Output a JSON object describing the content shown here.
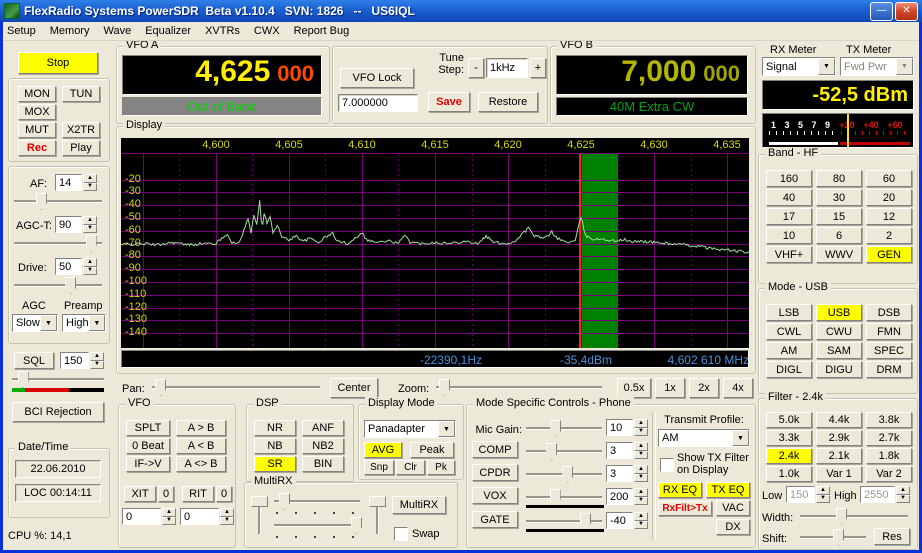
{
  "window": {
    "title": "FlexRadio Systems PowerSDR  Beta v1.10.4   SVN: 1826   --   US6IQL"
  },
  "menu": {
    "items": [
      "Setup",
      "Memory",
      "Wave",
      "Equalizer",
      "XVTRs",
      "CWX",
      "Report Bug"
    ]
  },
  "left": {
    "stop": "Stop",
    "mon": "MON",
    "tun": "TUN",
    "mox": "MOX",
    "mut": "MUT",
    "x2tr": "X2TR",
    "rec": "Rec",
    "play": "Play",
    "af_label": "AF:",
    "af_value": "14",
    "agct_label": "AGC-T:",
    "agct_value": "90",
    "drive_label": "Drive:",
    "drive_value": "50",
    "agc_label": "AGC",
    "agc_value": "Slow",
    "preamp_label": "Preamp",
    "preamp_value": "High",
    "sql_label": "SQL",
    "sql_value": "150",
    "bci_label": "BCI Rejection",
    "datetime_label": "Date/Time",
    "date": "22.06.2010",
    "loc_time": "LOC 00:14:11",
    "cpu": "CPU %: 14,1"
  },
  "vfo_a": {
    "label": "VFO A",
    "digits": "4,625",
    "sub_digits": "000",
    "band_text": "Out of Band"
  },
  "tune": {
    "vfo_lock": "VFO Lock",
    "freq_entry": "7.000000",
    "step_label_1": "Tune",
    "step_label_2": "Step:",
    "minus": "-",
    "step": "1kHz",
    "plus": "+",
    "save": "Save",
    "restore": "Restore"
  },
  "vfo_b": {
    "label": "VFO B",
    "digits": "7,000",
    "sub_digits": "000",
    "band_text": "40M Extra CW"
  },
  "meters": {
    "rx_label": "RX Meter",
    "tx_label": "TX Meter",
    "rx_selected": "Signal",
    "tx_selected": "Fwd Pwr",
    "reading": "-52,5 dBm",
    "smeter_white": [
      "1",
      "3",
      "5",
      "7",
      "9"
    ],
    "smeter_red": [
      "+20",
      "+40",
      "+60"
    ]
  },
  "band_panel": {
    "label": "Band - HF",
    "buttons": [
      "160",
      "80",
      "60",
      "40",
      "30",
      "20",
      "17",
      "15",
      "12",
      "10",
      "6",
      "2",
      "VHF+",
      "WWV",
      "GEN"
    ],
    "active": "GEN"
  },
  "mode_panel": {
    "label": "Mode - USB",
    "buttons": [
      "LSB",
      "USB",
      "DSB",
      "CWL",
      "CWU",
      "FMN",
      "AM",
      "SAM",
      "SPEC",
      "DIGL",
      "DIGU",
      "DRM"
    ],
    "active": "USB"
  },
  "filter_panel": {
    "label": "Filter - 2.4k",
    "buttons": [
      "5.0k",
      "4.4k",
      "3.8k",
      "3.3k",
      "2.9k",
      "2.7k",
      "2.4k",
      "2.1k",
      "1.8k",
      "1.0k",
      "Var 1",
      "Var 2"
    ],
    "active": "2.4k",
    "low_label": "Low",
    "low_value": "150",
    "high_label": "High",
    "high_value": "2550",
    "width_label": "Width:",
    "shift_label": "Shift:",
    "res": "Res"
  },
  "display": {
    "label": "Display",
    "freq_ticks": [
      "4,600",
      "4,605",
      "4,610",
      "4,615",
      "4,620",
      "4,625",
      "4,630",
      "4,635"
    ],
    "db_max": -20,
    "db_min": -140,
    "db_step": 10,
    "axis": {
      "fmin_khz": 4593.5,
      "fmax_khz": 4636.5
    },
    "passband": {
      "start_khz": 4625.0,
      "width_khz": 2.55
    },
    "status_hz": "-22390,1Hz",
    "status_dbm": "-35,4dBm",
    "status_freq": "4,602 610 MHz",
    "trace": [
      [
        4593.5,
        -71
      ],
      [
        4595,
        -70
      ],
      [
        4596,
        -71
      ],
      [
        4597,
        -69
      ],
      [
        4598,
        -71
      ],
      [
        4599,
        -70
      ],
      [
        4600,
        -70
      ],
      [
        4600.8,
        -62
      ],
      [
        4601.1,
        -70
      ],
      [
        4601.6,
        -69
      ],
      [
        4602,
        -57
      ],
      [
        4602.2,
        -50
      ],
      [
        4602.4,
        -62
      ],
      [
        4602.6,
        -48
      ],
      [
        4602.8,
        -55
      ],
      [
        4603,
        -35
      ],
      [
        4603.15,
        -60
      ],
      [
        4603.3,
        -46
      ],
      [
        4603.5,
        -55
      ],
      [
        4603.7,
        -48
      ],
      [
        4603.9,
        -62
      ],
      [
        4604.2,
        -55
      ],
      [
        4604.5,
        -65
      ],
      [
        4605,
        -67
      ],
      [
        4605.5,
        -64
      ],
      [
        4606,
        -68
      ],
      [
        4606.5,
        -66
      ],
      [
        4607,
        -69
      ],
      [
        4607.5,
        -65
      ],
      [
        4608,
        -62
      ],
      [
        4608.3,
        -68
      ],
      [
        4609,
        -70
      ],
      [
        4609.5,
        -66
      ],
      [
        4610,
        -61
      ],
      [
        4610.3,
        -67
      ],
      [
        4611,
        -69
      ],
      [
        4612,
        -68
      ],
      [
        4612.5,
        -70
      ],
      [
        4613,
        -63
      ],
      [
        4613.3,
        -69
      ],
      [
        4614,
        -70
      ],
      [
        4615,
        -69
      ],
      [
        4616,
        -70
      ],
      [
        4617,
        -68
      ],
      [
        4618,
        -70
      ],
      [
        4618.5,
        -64
      ],
      [
        4619,
        -69
      ],
      [
        4620,
        -70
      ],
      [
        4620.5,
        -68
      ],
      [
        4621,
        -62
      ],
      [
        4621.4,
        -58
      ],
      [
        4621.8,
        -64
      ],
      [
        4622.5,
        -66
      ],
      [
        4623,
        -61
      ],
      [
        4623.4,
        -66
      ],
      [
        4624,
        -69
      ],
      [
        4624.6,
        -68
      ],
      [
        4625,
        -49
      ],
      [
        4625.3,
        -64
      ],
      [
        4626,
        -67
      ],
      [
        4626.5,
        -66
      ],
      [
        4627,
        -68
      ],
      [
        4628,
        -67
      ],
      [
        4628.5,
        -69
      ],
      [
        4629,
        -68
      ],
      [
        4630,
        -69
      ],
      [
        4631,
        -70
      ],
      [
        4632,
        -71
      ],
      [
        4633,
        -72
      ],
      [
        4634,
        -74
      ],
      [
        4635,
        -75
      ],
      [
        4636.5,
        -77
      ]
    ]
  },
  "panzoom": {
    "pan_label": "Pan:",
    "center": "Center",
    "zoom_label": "Zoom:",
    "zoom_buttons": [
      "0.5x",
      "1x",
      "2x",
      "4x"
    ]
  },
  "vfo_ctrl": {
    "label": "VFO",
    "splt": "SPLT",
    "a_gt_b": "A > B",
    "zero_beat": "0 Beat",
    "a_lt_b": "A < B",
    "if_v": "IF->V",
    "a_swap_b": "A <> B",
    "xit": "XIT",
    "xit_clear": "0",
    "rit": "RIT",
    "rit_clear": "0",
    "xit_value": "0",
    "rit_value": "0"
  },
  "dsp_panel": {
    "label": "DSP",
    "nr": "NR",
    "anf": "ANF",
    "nb": "NB",
    "nb2": "NB2",
    "sr": "SR",
    "bin": "BIN",
    "active": "SR"
  },
  "multirx": {
    "label": "MultiRX",
    "button": "MultiRX",
    "swap_label": "Swap"
  },
  "display_mode": {
    "label": "Display Mode",
    "selected": "Panadapter",
    "avg": "AVG",
    "peak": "Peak",
    "snp": "Snp",
    "clr": "Clr",
    "pk": "Pk",
    "active": "AVG"
  },
  "msc": {
    "label": "Mode Specific Controls - Phone",
    "mic_label": "Mic Gain:",
    "mic_value": "10",
    "comp": "COMP",
    "comp_value": "3",
    "cpdr": "CPDR",
    "cpdr_value": "3",
    "vox": "VOX",
    "vox_value": "200",
    "gate": "GATE",
    "gate_value": "-40",
    "tx_profile_label": "Transmit Profile:",
    "tx_profile": "AM",
    "show_tx_label": "Show TX Filter on Display",
    "rx_eq": "RX EQ",
    "tx_eq": "TX EQ",
    "rxfilt_tx": "RxFilt>Tx",
    "vac": "VAC",
    "dx": "DX"
  }
}
